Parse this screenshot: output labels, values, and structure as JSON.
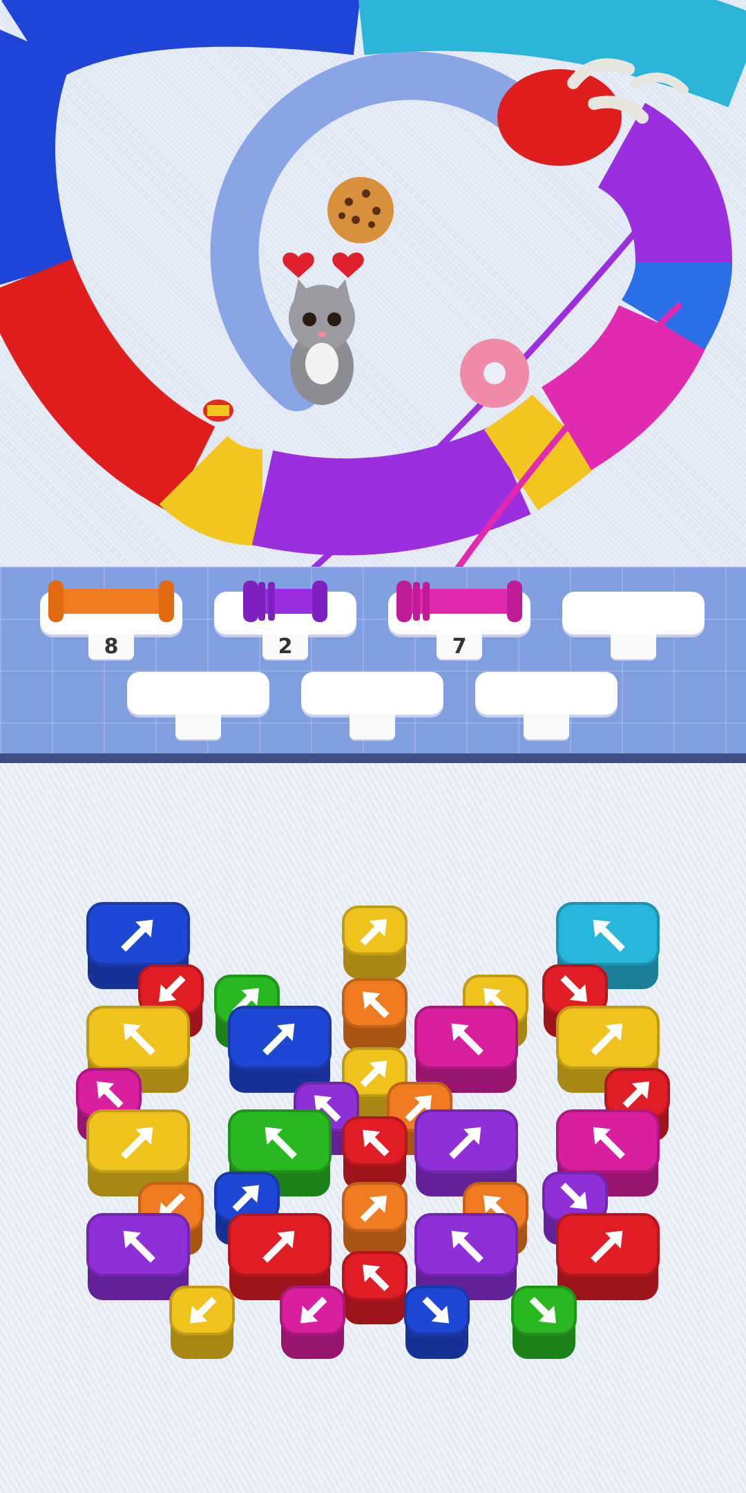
{
  "slots": {
    "top_row": [
      {
        "count": "8",
        "spool_color": "#f07a20",
        "filled": true
      },
      {
        "count": "2",
        "spool_color": "#9b2fe0",
        "filled": true
      },
      {
        "count": "7",
        "spool_color": "#e22ab0",
        "filled": true
      },
      {
        "count": "",
        "spool_color": "",
        "filled": false
      }
    ],
    "bottom_row": [
      {
        "count": "",
        "filled": false
      },
      {
        "count": "",
        "filled": false
      },
      {
        "count": "",
        "filled": false
      }
    ]
  },
  "board": {
    "items": [
      "cookie-icon",
      "donut-icon",
      "candy-icon",
      "kitten-icon",
      "heart-icon"
    ],
    "dragon_segment_colors": [
      "#1e44d8",
      "#e01d1d",
      "#f2c51f",
      "#9b2fe0",
      "#e22ab0",
      "#2a6ee8",
      "#2ab4d8"
    ]
  },
  "palette": {
    "blue": "#1f47d6",
    "red": "#e01d25",
    "yellow": "#f0c21c",
    "green": "#28b820",
    "orange": "#f07a20",
    "purple": "#8e2fd8",
    "pink": "#d91e9e",
    "cyan": "#27b6dc"
  }
}
